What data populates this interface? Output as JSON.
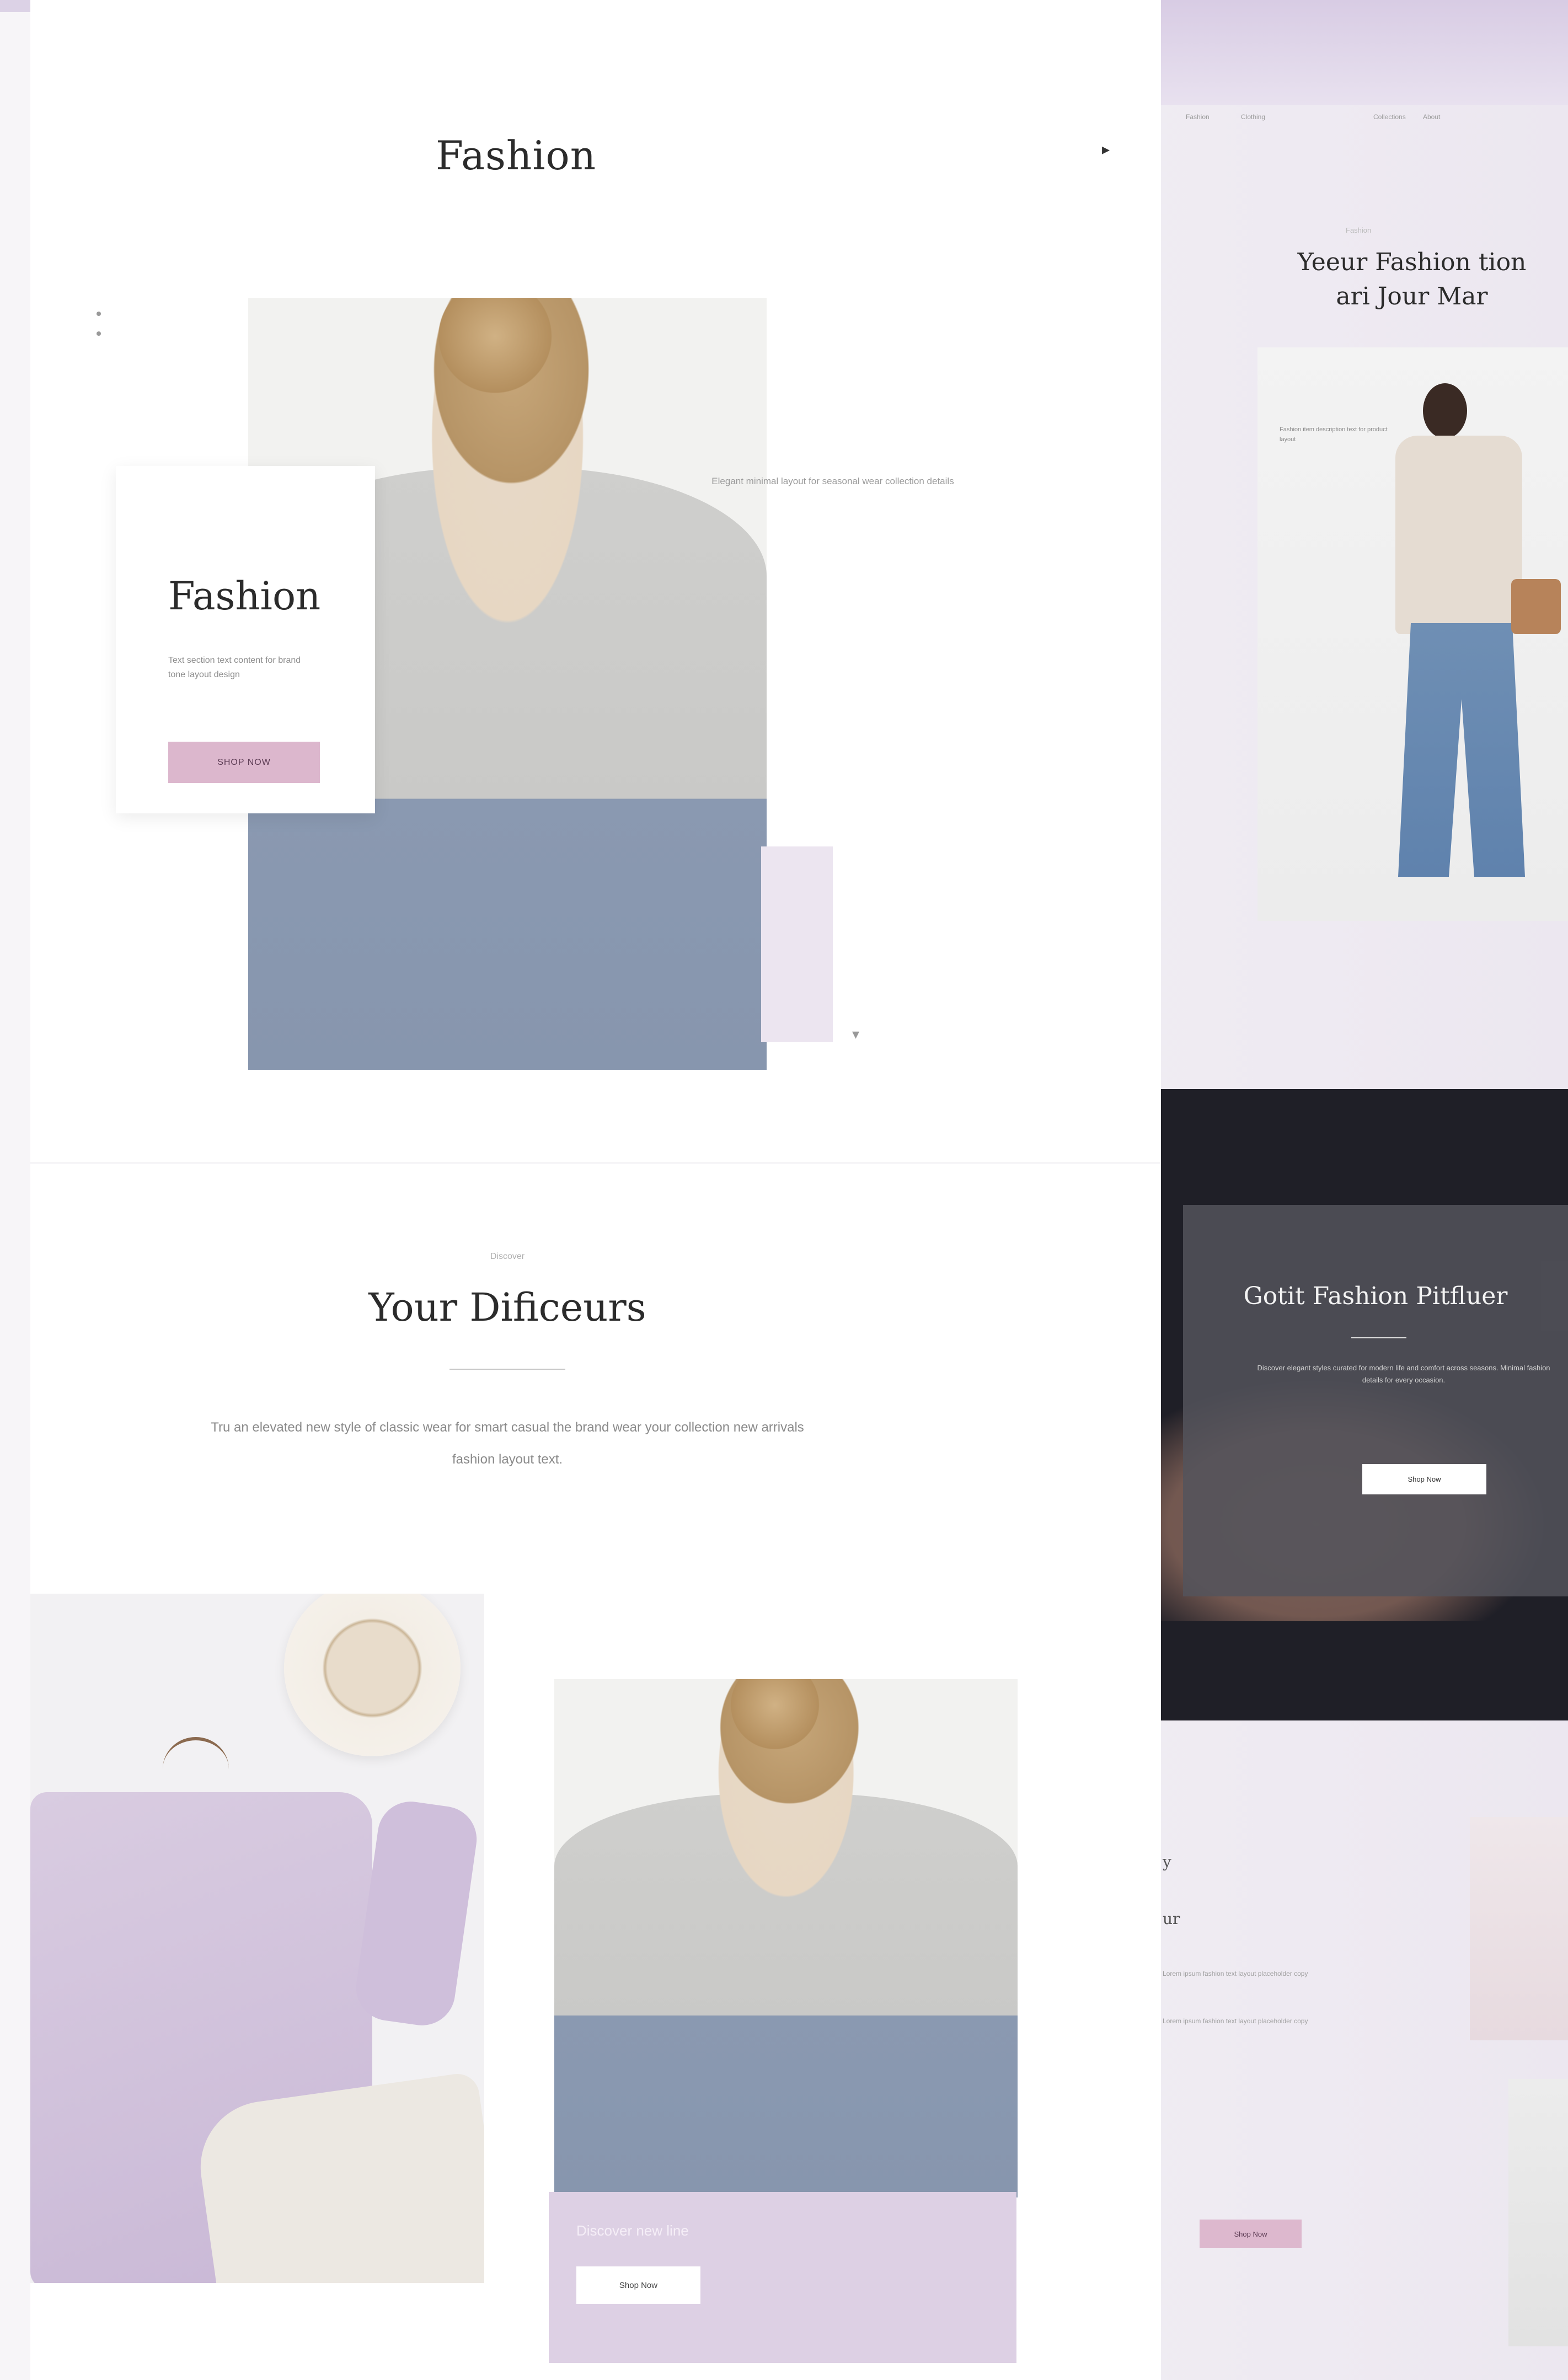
{
  "brand": "Fashion",
  "sidenav": [
    "",
    ""
  ],
  "hero": {
    "card_title": "Fashion",
    "card_desc": "Text section text content for brand tone layout design",
    "cta": "SHOP NOW",
    "side_text": "Elegant minimal layout for seasonal wear collection details"
  },
  "section2": {
    "kicker": "Discover",
    "title": "Your Dificeurs",
    "desc": "Tru an elevated new style of classic wear for smart casual the brand wear your collection new arrivals fashion layout text."
  },
  "promo_card": {
    "text": "Discover new line",
    "cta": "Shop Now"
  },
  "right_page": {
    "nav": [
      "Fashion",
      "Clothing",
      "Collections",
      "About"
    ],
    "kicker": "Fashion",
    "title_line1": "Yeeur Fashion tion",
    "title_line2": "ari Jour Mar",
    "model_info": "Fashion item description text for product layout"
  },
  "dark_section": {
    "title": "Gotit Fashion Pitfluer",
    "desc": "Discover elegant styles curated for modern life and comfort across seasons. Minimal fashion details for every occasion.",
    "cta": "Shop Now"
  },
  "bottom_right": {
    "heading1": "y",
    "heading2": "ur",
    "para1": "Lorem ipsum fashion text layout placeholder copy",
    "para2": "Lorem ipsum fashion text layout placeholder copy",
    "cta": "Shop Now"
  }
}
